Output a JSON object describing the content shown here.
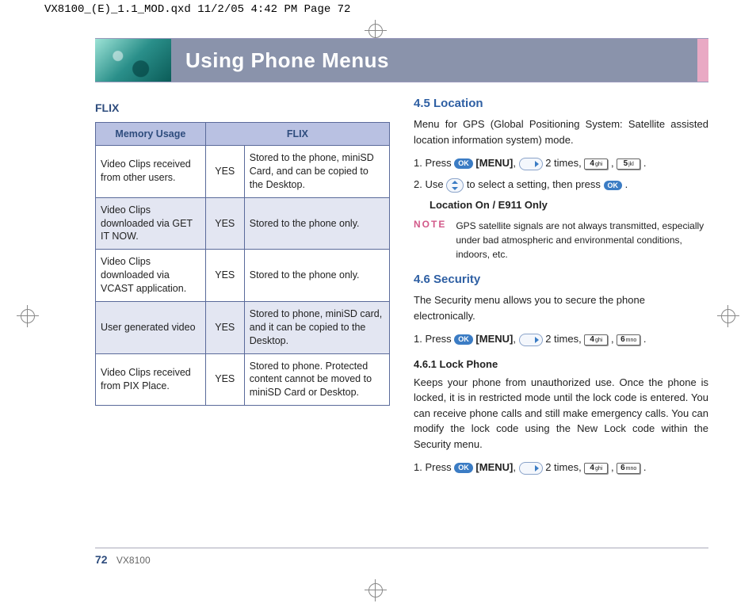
{
  "header_line": "VX8100_(E)_1.1_MOD.qxd  11/2/05  4:42 PM  Page 72",
  "banner_title": "Using Phone Menus",
  "left": {
    "heading": "FLIX",
    "table": {
      "header_memory": "Memory Usage",
      "header_flix": "FLIX",
      "rows": [
        {
          "memory": "Video Clips received from other users.",
          "yes": "YES",
          "flix": "Stored to the phone, miniSD Card, and can be copied to the Desktop."
        },
        {
          "memory": "Video Clips downloaded via GET IT NOW.",
          "yes": "YES",
          "flix": "Stored to the phone only."
        },
        {
          "memory": "Video Clips downloaded via VCAST application.",
          "yes": "YES",
          "flix": "Stored to the phone only."
        },
        {
          "memory": "User generated video",
          "yes": "YES",
          "flix": "Stored to phone, miniSD card, and it can be copied to the Desktop."
        },
        {
          "memory": "Video Clips received from PIX Place.",
          "yes": "YES",
          "flix": "Stored to phone. Protected content cannot be moved to miniSD Card or Desktop."
        }
      ]
    }
  },
  "right": {
    "loc_heading": "4.5 Location",
    "loc_intro": "Menu for GPS (Global Positioning System: Satellite assisted location information system) mode.",
    "step1_prefix": "1.  Press ",
    "step1_menu": "[MENU]",
    "step1_mid": ", ",
    "step1_times": " 2 times, ",
    "step1_comma": " , ",
    "step1_end": " .",
    "step2_prefix": "2.  Use ",
    "step2_mid": " to select a setting, then press ",
    "step2_end": " .",
    "loc_option": "Location On / E911 Only",
    "note_label": "NOTE",
    "note_text": "GPS satellite signals are not always transmitted, especially under bad atmospheric and environmental conditions, indoors, etc.",
    "sec_heading": "4.6 Security",
    "sec_intro": "The Security menu allows you to secure the phone electronically.",
    "sec_step1_prefix": "1.  Press ",
    "lock_heading": "4.6.1 Lock Phone",
    "lock_text": "Keeps your phone from unauthorized use. Once the phone is locked, it is in restricted mode until the lock code is entered. You can receive phone calls and still make emergency calls. You can modify the lock code using the New Lock code within the Security menu.",
    "lock_step1_prefix": "1.  Press "
  },
  "keys": {
    "ok": "OK",
    "k4": "4",
    "k4_sub": "ghi",
    "k5": "5",
    "k5_sub": "jkl",
    "k6": "6",
    "k6_sub": "mno"
  },
  "footer": {
    "page": "72",
    "model": "VX8100"
  }
}
